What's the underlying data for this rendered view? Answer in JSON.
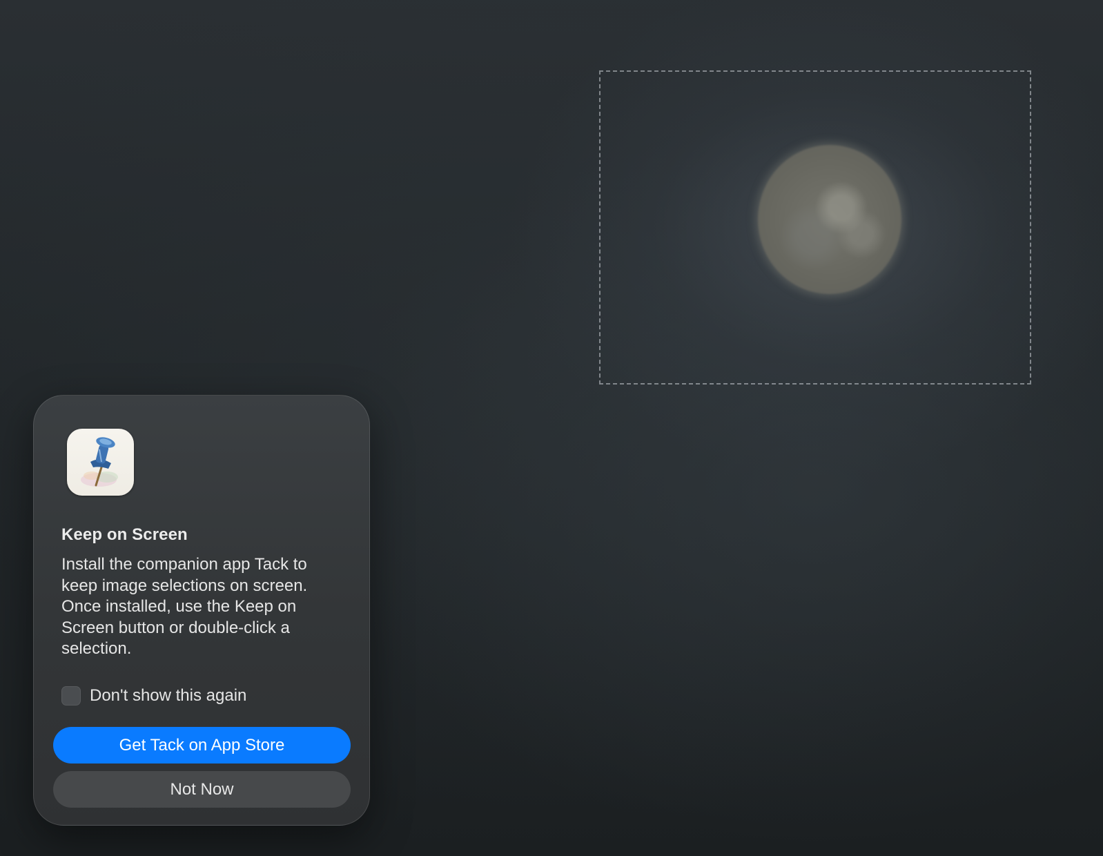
{
  "dialog": {
    "app_icon": "pushpin-icon",
    "title": "Keep on Screen",
    "message": "Install the companion app Tack to keep image selections on screen. Once installed, use the Keep on Screen button or double-click a selection.",
    "checkbox": {
      "label": "Don't show this again",
      "checked": false
    },
    "primary_button": "Get Tack on App Store",
    "secondary_button": "Not Now"
  },
  "colors": {
    "accent": "#0a7bff",
    "dialog_background": "#353839",
    "desktop_background": "#22272a"
  }
}
